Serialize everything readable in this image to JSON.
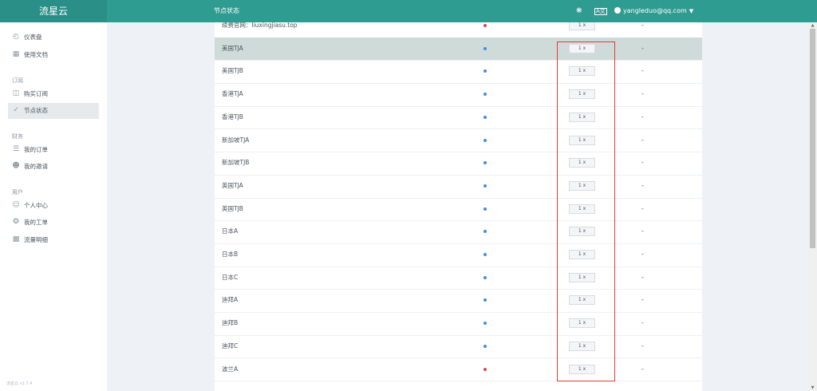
{
  "app": {
    "brand": "流星云",
    "page_title": "节点状态",
    "version": "流星云 v1.7.4"
  },
  "header": {
    "settings_icon": "gear-icon",
    "language_icon": "language-icon",
    "user_email": "yangleduo@qq.com"
  },
  "sidebar": {
    "items": [
      {
        "label": "仪表盘",
        "icon": "dashboard-icon"
      },
      {
        "label": "使用文档",
        "icon": "book-icon"
      }
    ],
    "sections": [
      {
        "title": "订阅",
        "items": [
          {
            "label": "购买订阅",
            "icon": "clipboard-icon"
          },
          {
            "label": "节点状态",
            "icon": "check-circle-icon",
            "active": true
          }
        ]
      },
      {
        "title": "财务",
        "items": [
          {
            "label": "我的订单",
            "icon": "list-icon"
          },
          {
            "label": "我的邀请",
            "icon": "user-plus-icon"
          }
        ]
      },
      {
        "title": "用户",
        "items": [
          {
            "label": "个人中心",
            "icon": "user-icon"
          },
          {
            "label": "我的工单",
            "icon": "support-icon"
          },
          {
            "label": "流量明细",
            "icon": "bar-chart-icon"
          }
        ]
      }
    ]
  },
  "nodes": [
    {
      "name": "续费官网：liuxingjiasu.top",
      "status": "red",
      "rate": "1 x",
      "tags": "-"
    },
    {
      "name": "美国TJA",
      "status": "blue",
      "rate": "1 x",
      "tags": "-",
      "highlight": true
    },
    {
      "name": "美国TJB",
      "status": "blue",
      "rate": "1 x",
      "tags": "-"
    },
    {
      "name": "香港TJA",
      "status": "blue",
      "rate": "1 x",
      "tags": "-"
    },
    {
      "name": "香港TJB",
      "status": "blue",
      "rate": "1 x",
      "tags": "-"
    },
    {
      "name": "新加坡TJA",
      "status": "blue",
      "rate": "1 x",
      "tags": "-"
    },
    {
      "name": "新加坡TJB",
      "status": "blue",
      "rate": "1 x",
      "tags": "-"
    },
    {
      "name": "英国TJA",
      "status": "blue",
      "rate": "1 x",
      "tags": "-"
    },
    {
      "name": "英国TJB",
      "status": "blue",
      "rate": "1 x",
      "tags": "-"
    },
    {
      "name": "日本A",
      "status": "blue",
      "rate": "1 x",
      "tags": "-"
    },
    {
      "name": "日本B",
      "status": "blue",
      "rate": "1 x",
      "tags": "-"
    },
    {
      "name": "日本C",
      "status": "blue",
      "rate": "1 x",
      "tags": "-"
    },
    {
      "name": "迪拜A",
      "status": "blue",
      "rate": "1 x",
      "tags": "-"
    },
    {
      "name": "迪拜B",
      "status": "blue",
      "rate": "1 x",
      "tags": "-"
    },
    {
      "name": "迪拜C",
      "status": "blue",
      "rate": "1 x",
      "tags": "-"
    },
    {
      "name": "波兰A",
      "status": "red",
      "rate": "1 x",
      "tags": "-"
    },
    {
      "name": "",
      "status": "",
      "rate": "",
      "tags": ""
    }
  ],
  "colors": {
    "topbar": "#2f9c92",
    "status_blue": "#3d8fe0",
    "status_red": "#e0474c",
    "annotation_red": "#e53935"
  }
}
